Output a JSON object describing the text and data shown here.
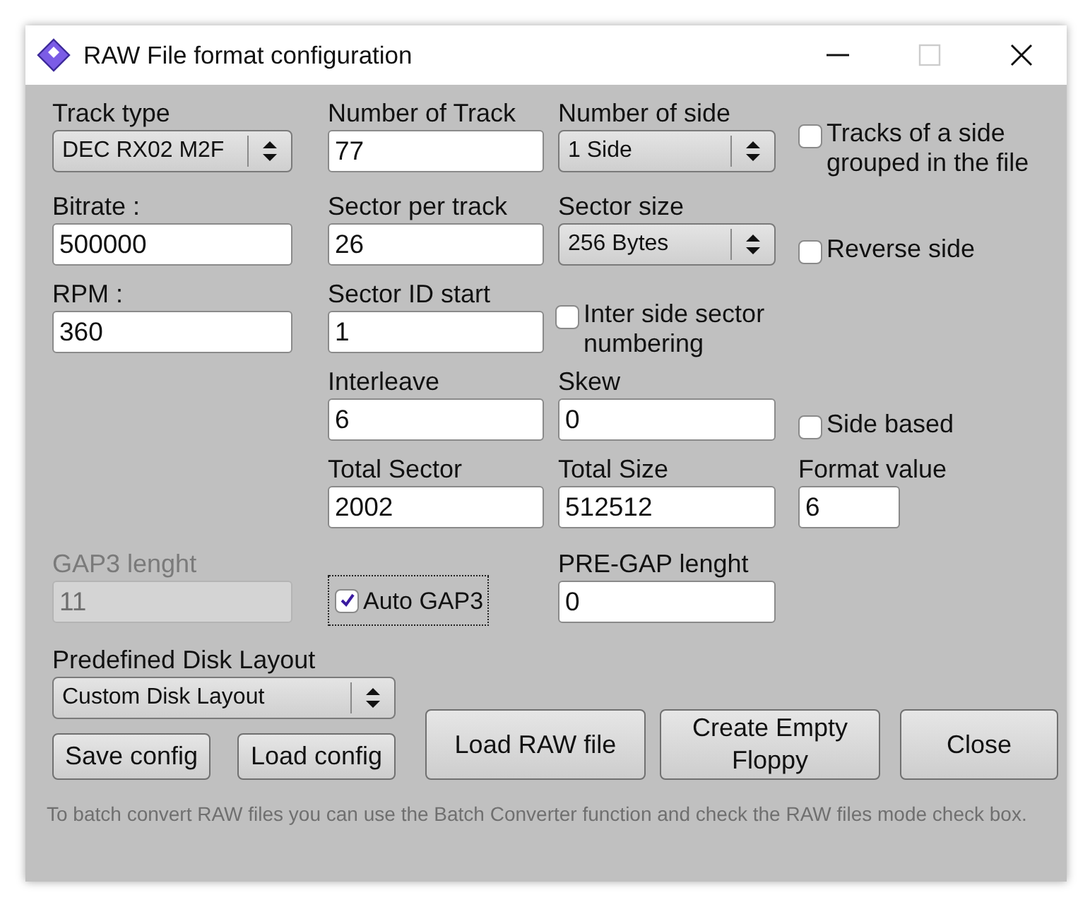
{
  "window": {
    "title": "RAW File format configuration"
  },
  "track_type": {
    "label": "Track type",
    "value": "DEC RX02 M2F"
  },
  "number_of_track": {
    "label": "Number of Track",
    "value": "77"
  },
  "number_of_side": {
    "label": "Number of side",
    "value": "1 Side"
  },
  "tracks_grouped": {
    "label": "Tracks of a side grouped in the file",
    "checked": false
  },
  "bitrate": {
    "label": "Bitrate :",
    "value": "500000"
  },
  "sector_per_track": {
    "label": "Sector per track",
    "value": "26"
  },
  "sector_size": {
    "label": "Sector size",
    "value": "256 Bytes"
  },
  "reverse_side": {
    "label": "Reverse side",
    "checked": false
  },
  "rpm": {
    "label": "RPM :",
    "value": "360"
  },
  "sector_id_start": {
    "label": "Sector ID start",
    "value": "1"
  },
  "inter_side": {
    "label": "Inter side sector numbering",
    "checked": false
  },
  "interleave": {
    "label": "Interleave",
    "value": "6"
  },
  "skew": {
    "label": "Skew",
    "value": "0"
  },
  "side_based": {
    "label": "Side based",
    "checked": false
  },
  "total_sector": {
    "label": "Total Sector",
    "value": "2002"
  },
  "total_size": {
    "label": "Total Size",
    "value": "512512"
  },
  "format_value": {
    "label": "Format value",
    "value": "6"
  },
  "gap3": {
    "label": "GAP3 lenght",
    "value": "11",
    "disabled": true
  },
  "auto_gap3": {
    "label": "Auto GAP3",
    "checked": true,
    "focused": true
  },
  "pre_gap": {
    "label": "PRE-GAP lenght",
    "value": "0"
  },
  "predefined_layout": {
    "label": "Predefined Disk Layout",
    "value": "Custom Disk Layout"
  },
  "buttons": [
    "Save config",
    "Load config",
    "Load RAW file",
    "Create Empty Floppy",
    "Close"
  ],
  "hint": "To batch convert RAW files you can use the Batch Converter function and check the RAW files mode check box."
}
